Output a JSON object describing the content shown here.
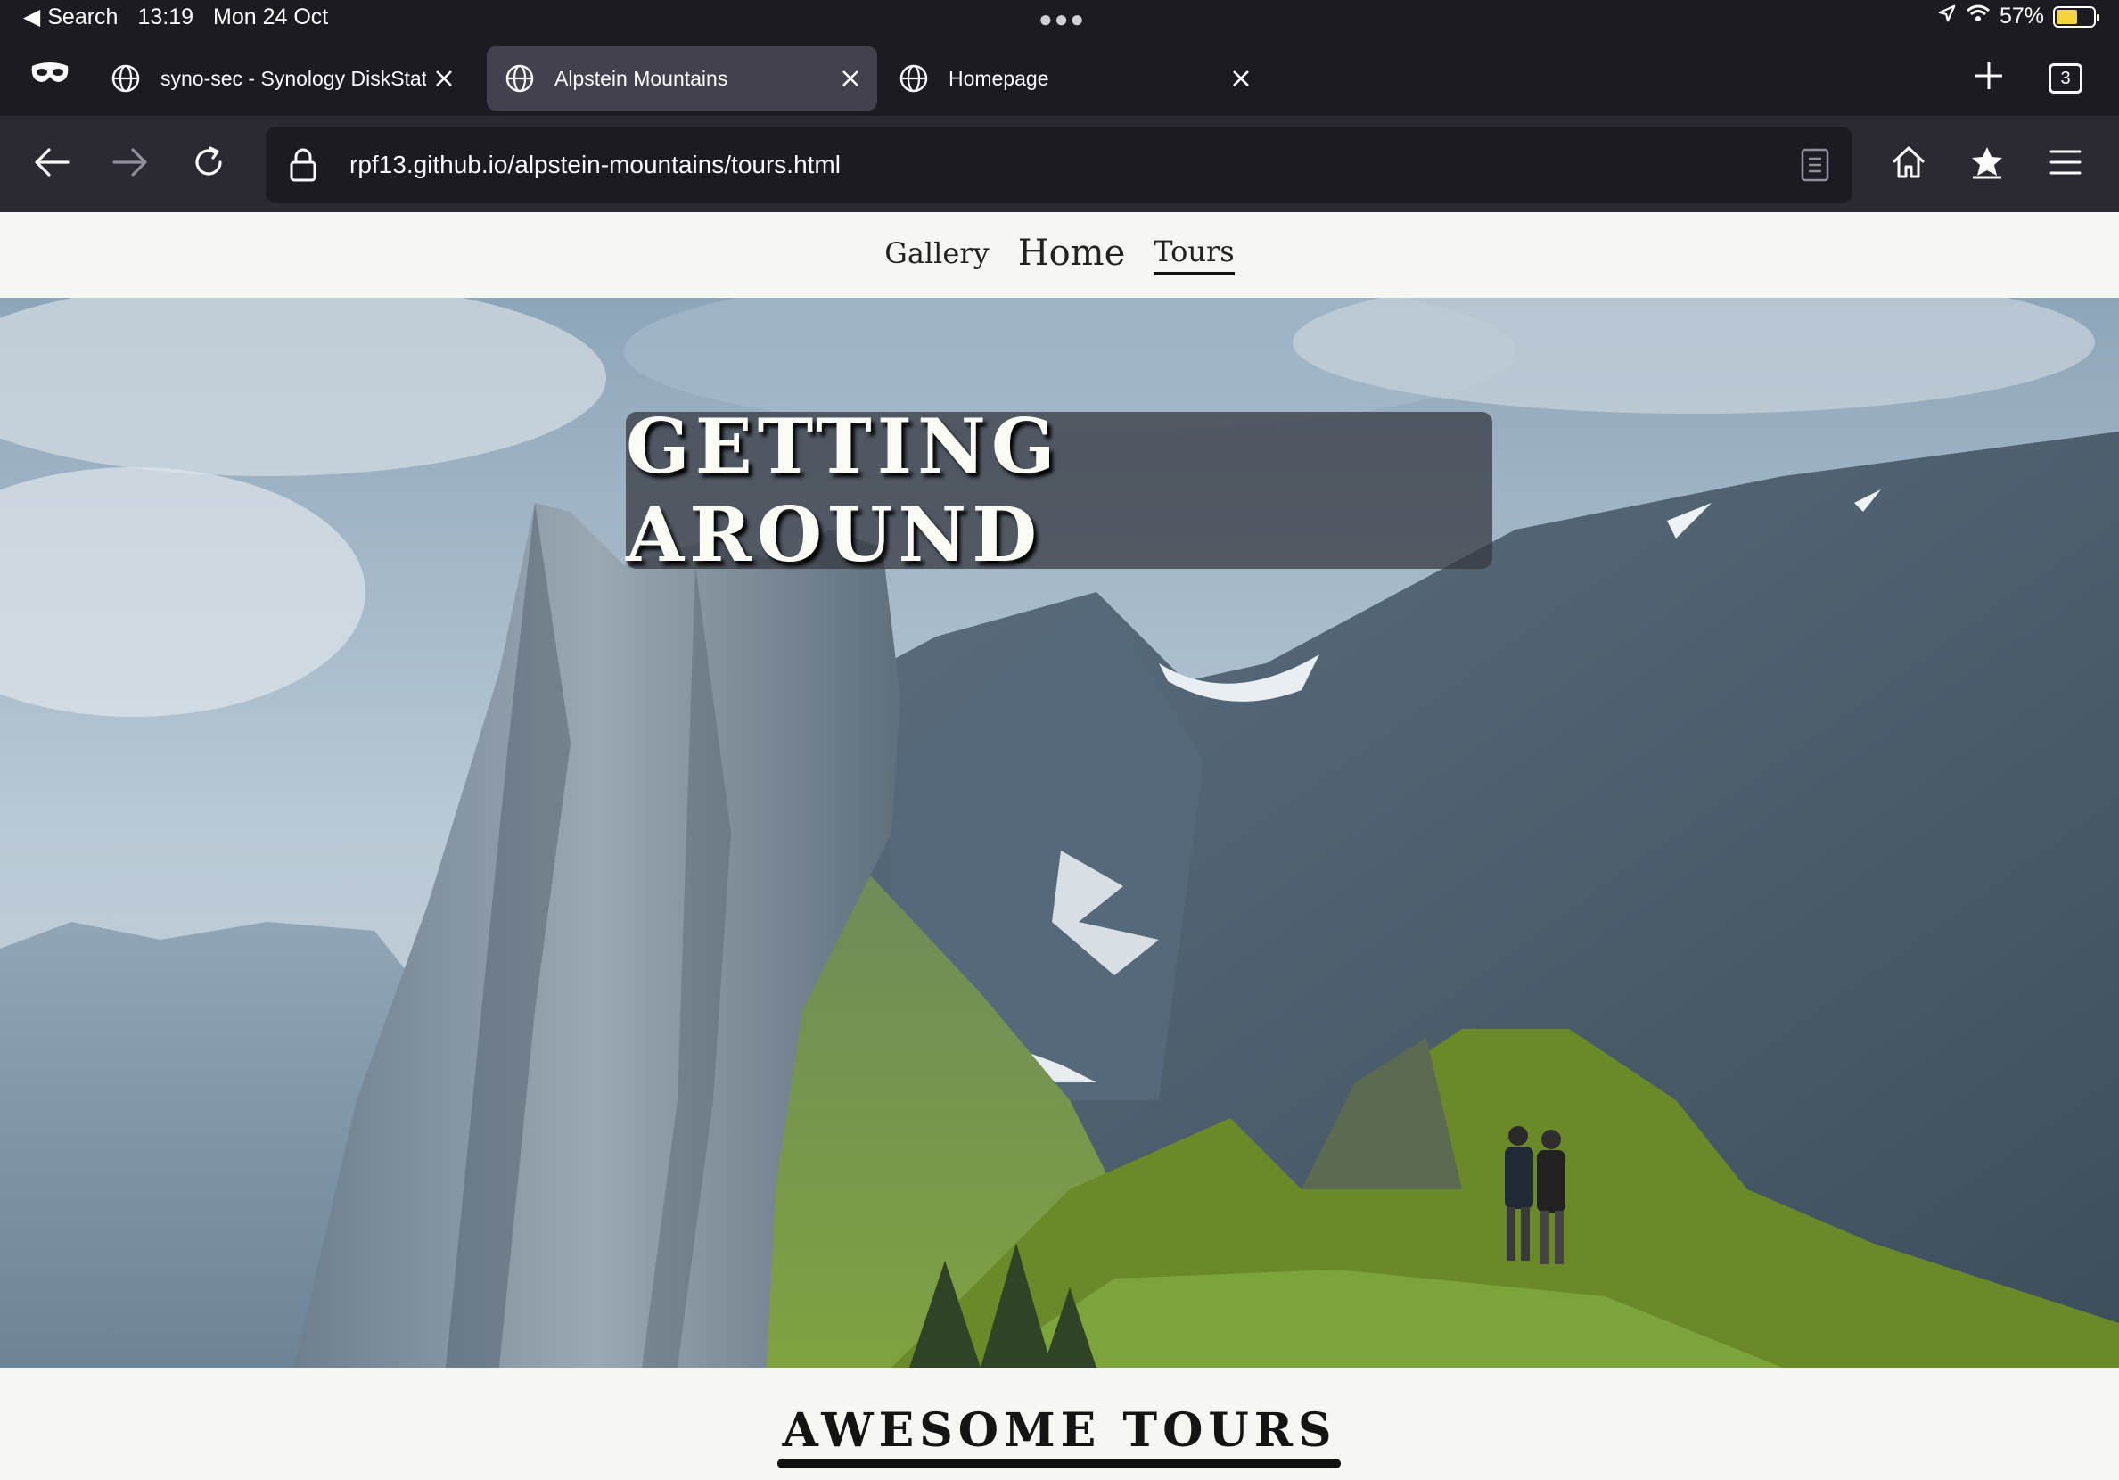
{
  "status_bar": {
    "back_label": "Search",
    "time": "13:19",
    "date": "Mon 24 Oct",
    "battery_percent": "57%",
    "battery_level": 0.57
  },
  "tabs": [
    {
      "title": "syno-sec - Synology DiskStat",
      "active": false
    },
    {
      "title": "Alpstein Mountains",
      "active": true
    },
    {
      "title": "Homepage",
      "active": false
    }
  ],
  "tab_count": "3",
  "toolbar": {
    "url": "rpf13.github.io/alpstein-mountains/tours.html"
  },
  "site_nav": {
    "gallery": "Gallery",
    "home": "Home",
    "tours": "Tours"
  },
  "hero": {
    "title": "GETTING AROUND"
  },
  "section": {
    "title": "AWESOME TOURS"
  },
  "icons": [
    "back-arrow-icon",
    "forward-arrow-icon",
    "reload-icon",
    "lock-icon",
    "reader-view-icon",
    "home-icon",
    "bookmark-star-icon",
    "menu-icon",
    "private-mask-icon",
    "globe-icon",
    "close-icon",
    "plus-icon",
    "location-icon",
    "wifi-icon",
    "battery-icon"
  ]
}
